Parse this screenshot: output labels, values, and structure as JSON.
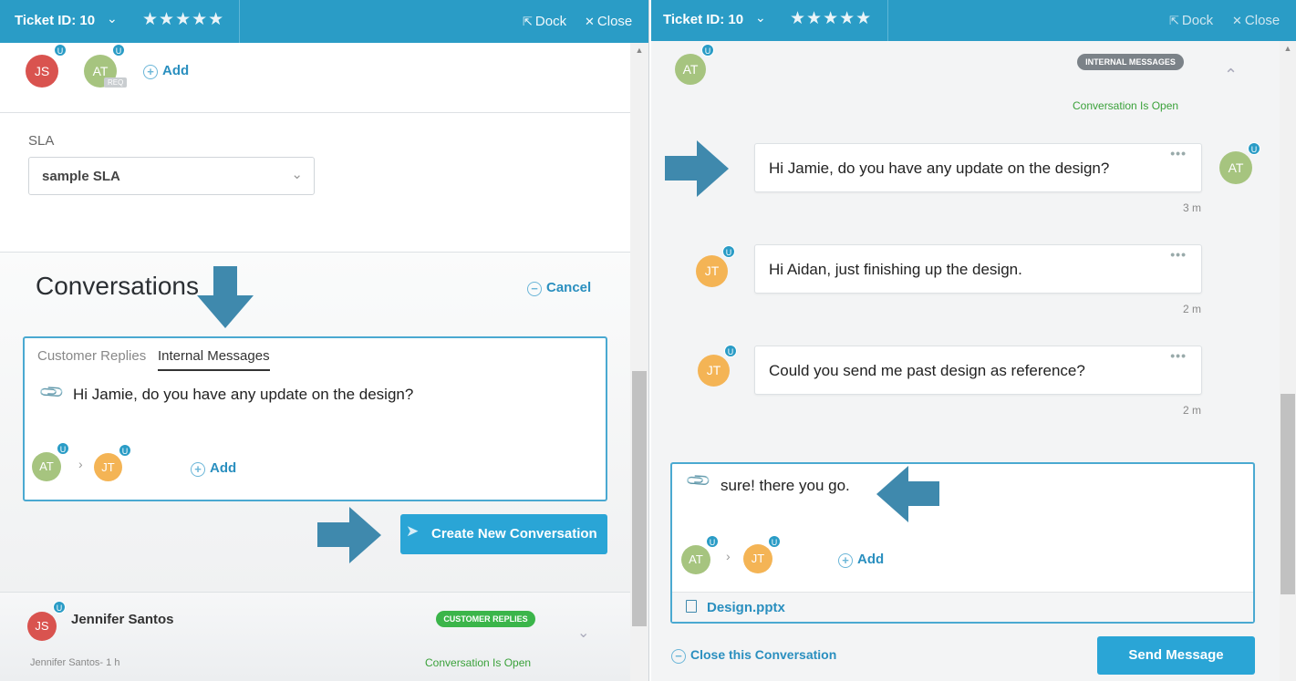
{
  "left": {
    "header": {
      "ticket_id": "Ticket ID: 10",
      "stars": "★★★★★",
      "dock": "Dock",
      "close": "Close"
    },
    "participants": [
      {
        "initials": "JS",
        "badge": "U"
      },
      {
        "initials": "AT",
        "badge": "U",
        "tag": "REQ"
      }
    ],
    "add_label": "Add",
    "sla": {
      "label": "SLA",
      "value": "sample SLA"
    },
    "conversations": {
      "title": "Conversations",
      "cancel": "Cancel"
    },
    "composer": {
      "tabs": [
        "Customer Replies",
        "Internal Messages"
      ],
      "active_tab": "Internal Messages",
      "text": "Hi Jamie, do you have any update on the design?",
      "from": {
        "initials": "AT",
        "badge": "U"
      },
      "to": {
        "initials": "JT",
        "badge": "U"
      },
      "add_label": "Add"
    },
    "create_button": "Create New Conversation",
    "conversation_item": {
      "avatar": {
        "initials": "JS",
        "badge": "U"
      },
      "name": "Jennifer Santos",
      "badge": "CUSTOMER REPLIES",
      "meta": "Jennifer Santos- 1 h",
      "status": "Conversation Is Open"
    }
  },
  "right": {
    "header": {
      "ticket_id": "Ticket ID: 10",
      "stars": "★★★★★",
      "dock": "Dock",
      "close": "Close"
    },
    "top_avatar": {
      "initials": "AT",
      "badge": "U"
    },
    "badge": "INTERNAL MESSAGES",
    "status": "Conversation Is Open",
    "messages": [
      {
        "text": "Hi Jamie, do you have any update on the design?",
        "time": "3 m",
        "avatar": "AT",
        "badge": "U"
      },
      {
        "text": "Hi Aidan, just finishing up the design.",
        "time": "2 m",
        "avatar": "JT",
        "badge": "U"
      },
      {
        "text": "Could you send me past design as reference?",
        "time": "2 m",
        "avatar": "JT",
        "badge": "U"
      }
    ],
    "reply": {
      "text": "sure! there you go.",
      "from": {
        "initials": "AT",
        "badge": "U"
      },
      "to": {
        "initials": "JT",
        "badge": "U"
      },
      "add_label": "Add",
      "attachment": "Design.pptx"
    },
    "close_conversation": "Close this Conversation",
    "send_button": "Send Message"
  },
  "colors": {
    "primary": "#2a9cc6",
    "accent_text": "#2a8fbf",
    "arrow": "#3f89ad",
    "open_status": "#3aa13a",
    "customer_badge": "#3bb54a",
    "internal_badge": "#7b8288"
  },
  "icons": {
    "dock": "dock-icon",
    "close": "close-icon",
    "attach": "paperclip-icon",
    "send": "paper-plane-icon",
    "file": "file-icon"
  }
}
